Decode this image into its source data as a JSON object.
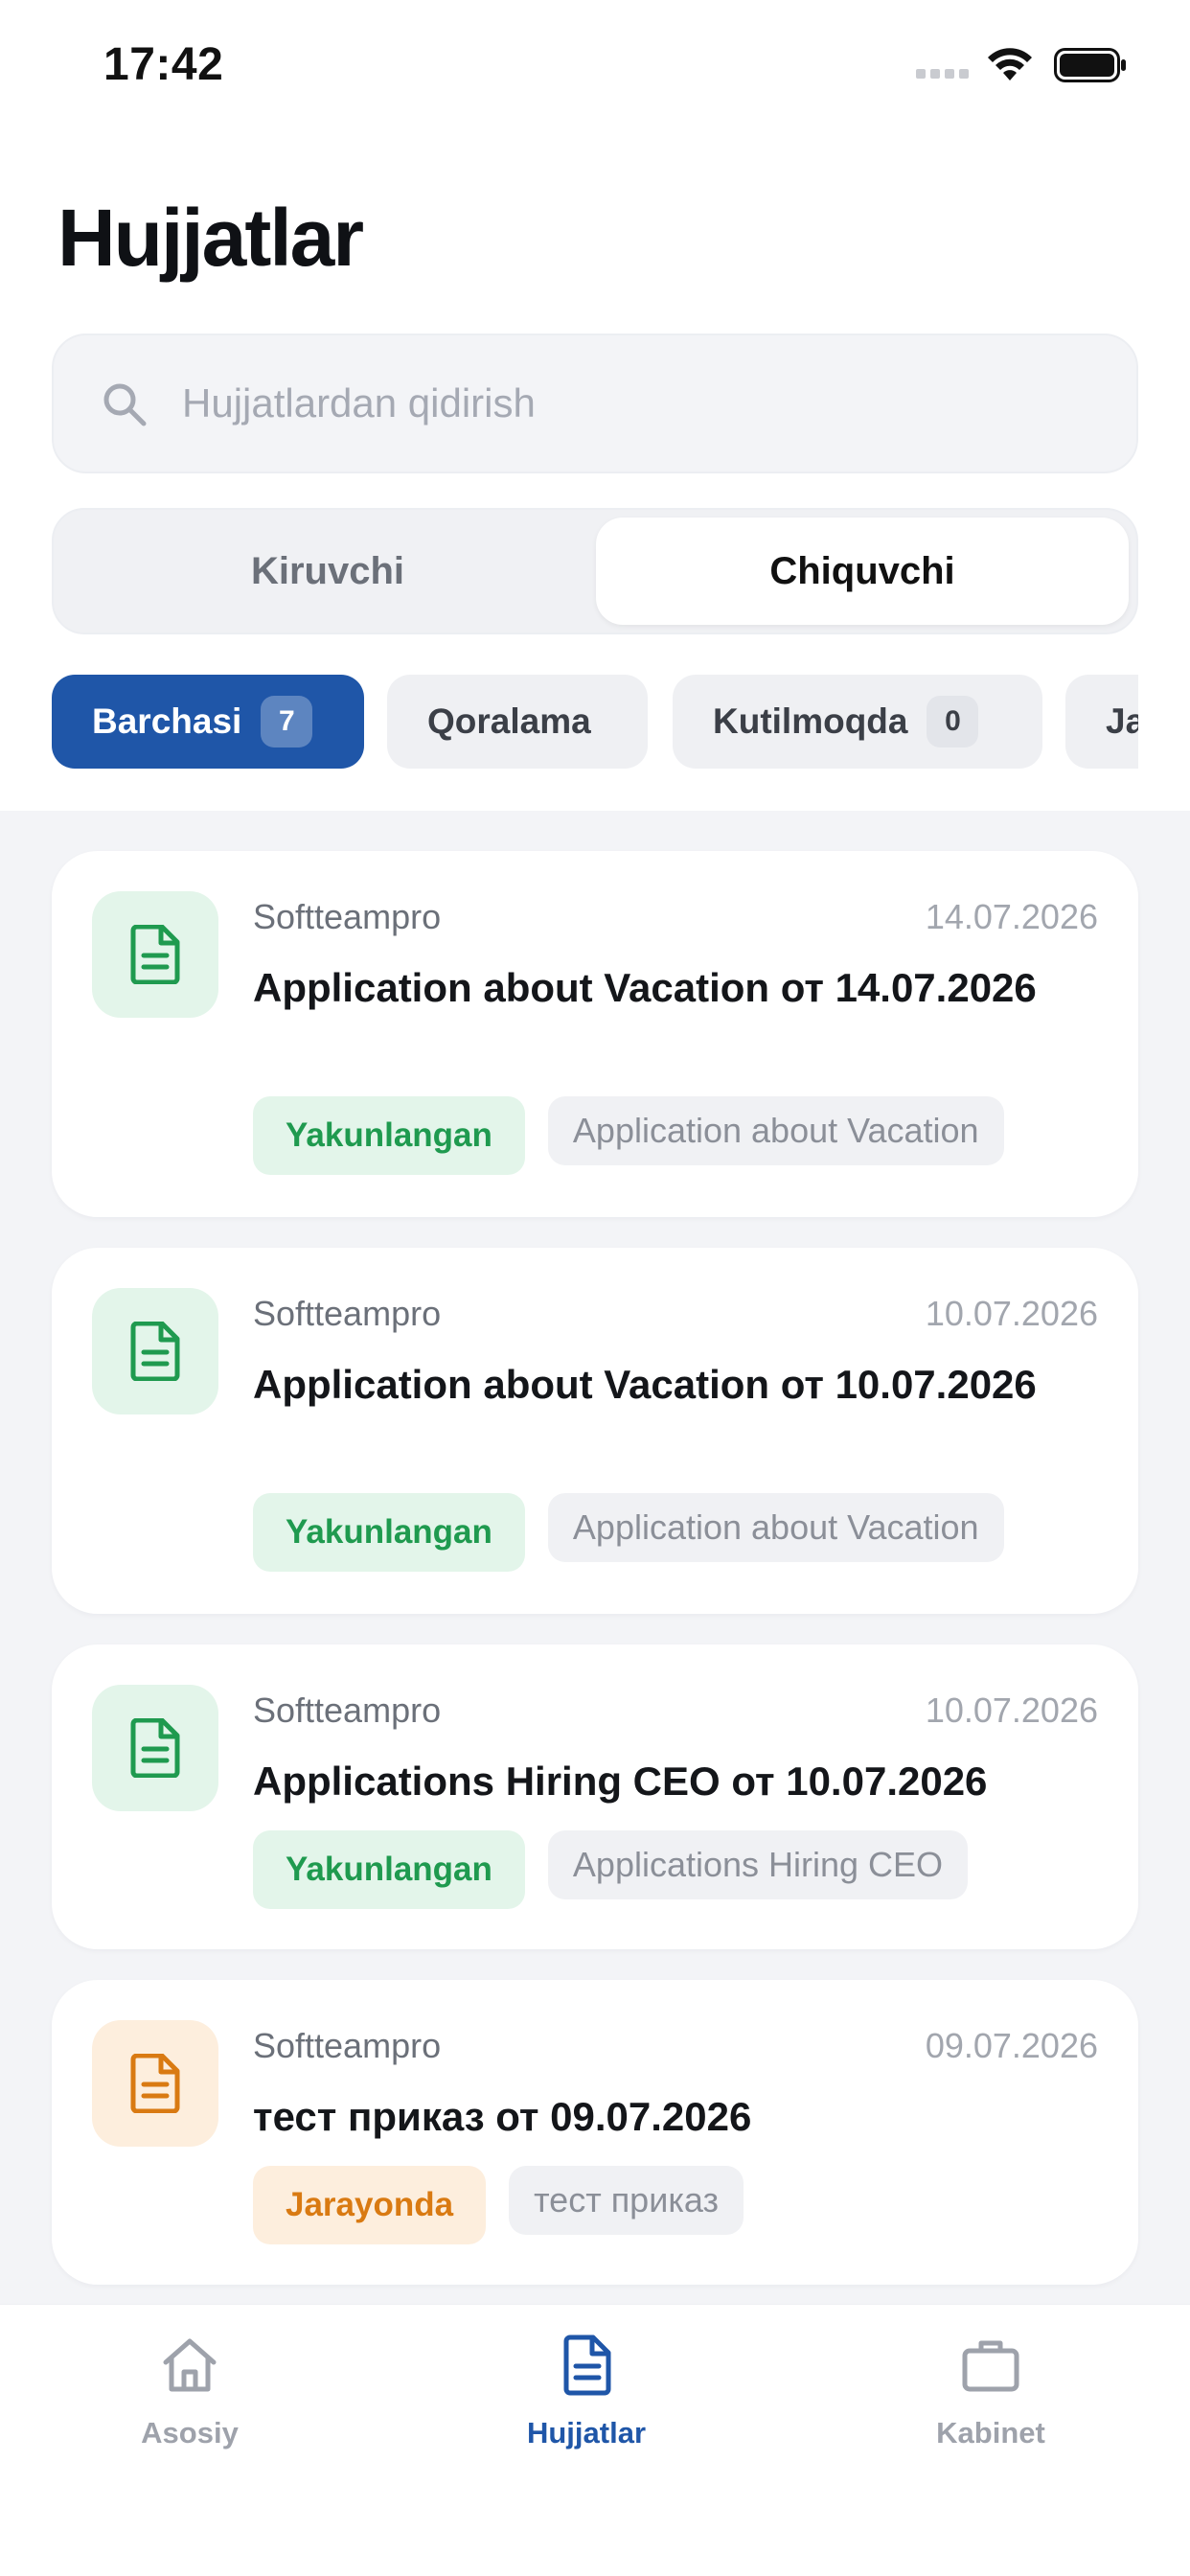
{
  "status_bar": {
    "time": "17:42"
  },
  "header": {
    "title": "Hujjatlar"
  },
  "search": {
    "placeholder": "Hujjatlardan qidirish"
  },
  "segments": {
    "incoming": "Kiruvchi",
    "outgoing": "Chiquvchi",
    "selected": "outgoing"
  },
  "filters": [
    {
      "label": "Barchasi",
      "count": "7",
      "active": true
    },
    {
      "label": "Qoralama"
    },
    {
      "label": "Kutilmoqda",
      "count": "0"
    },
    {
      "label": "Ja"
    }
  ],
  "documents": [
    {
      "org": "Softteampro",
      "date": "14.07.2026",
      "title": "Application about Vacation от 14.07.2026",
      "status": "Yakunlangan",
      "status_kind": "done",
      "type": "Application about Vacation"
    },
    {
      "org": "Softteampro",
      "date": "10.07.2026",
      "title": "Application about Vacation от 10.07.2026",
      "status": "Yakunlangan",
      "status_kind": "done",
      "type": "Application about Vacation"
    },
    {
      "org": "Softteampro",
      "date": "10.07.2026",
      "title": "Applications Hiring CEO от 10.07.2026",
      "status": "Yakunlangan",
      "status_kind": "done",
      "type": "Applications Hiring CEO"
    },
    {
      "org": "Softteampro",
      "date": "09.07.2026",
      "title": "тест приказ от 09.07.2026",
      "status": "Jarayonda",
      "status_kind": "progress",
      "type": "тест приказ"
    }
  ],
  "nav": [
    {
      "label": "Asosiy",
      "icon": "home-icon"
    },
    {
      "label": "Hujjatlar",
      "icon": "document-icon",
      "active": true
    },
    {
      "label": "Kabinet",
      "icon": "briefcase-icon"
    }
  ],
  "colors": {
    "accent": "#1f56a8",
    "done": "#1f9a4f",
    "progress": "#d97a12"
  }
}
